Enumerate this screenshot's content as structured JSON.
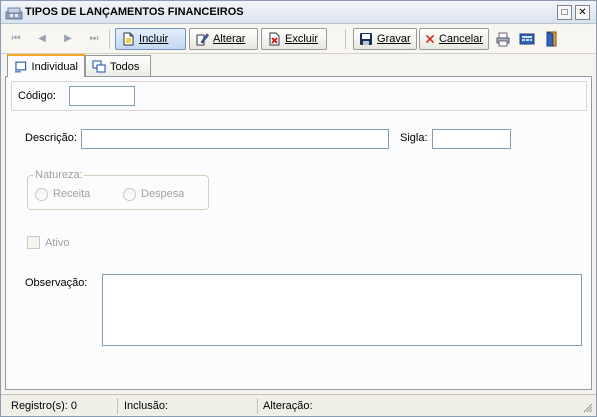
{
  "window": {
    "title": "TIPOS DE LANÇAMENTOS FINANCEIROS",
    "restore_label": "□",
    "close_label": "✕"
  },
  "toolbar": {
    "nav": [
      "⏮",
      "◀",
      "▶",
      "⏭"
    ],
    "incluir": "Incluir",
    "alterar": "Alterar",
    "excluir": "Excluir",
    "gravar": "Gravar",
    "cancelar": "Cancelar"
  },
  "tabs": {
    "individual": "Individual",
    "todos": "Todos"
  },
  "form": {
    "codigo_label": "Código:",
    "codigo_value": "",
    "descricao_label": "Descrição:",
    "descricao_value": "",
    "sigla_label": "Sigla:",
    "sigla_value": "",
    "natureza_label": "Natureza:",
    "receita_label": "Receita",
    "despesa_label": "Despesa",
    "ativo_label": "Ativo",
    "observacao_label": "Observação:",
    "observacao_value": ""
  },
  "status": {
    "registros": "Registro(s): 0",
    "inclusao": "Inclusão:",
    "alteracao": "Alteração:"
  },
  "colors": {
    "accent": "#f5a623",
    "input_border": "#7f9db9",
    "disabled_text": "#a0a0a0"
  }
}
